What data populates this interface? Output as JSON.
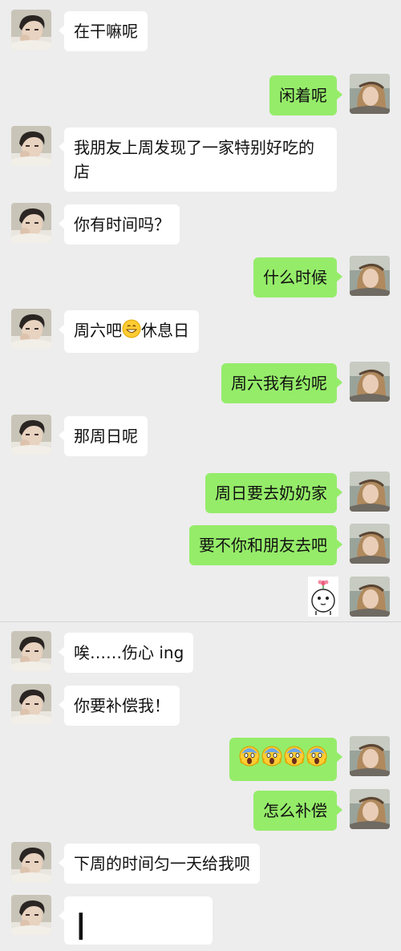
{
  "messages": [
    {
      "side": "in",
      "text": "在干嘛呢"
    },
    {
      "side": "out",
      "text": "闲着呢"
    },
    {
      "side": "in",
      "text": "我朋友上周发现了一家特别好吃的店"
    },
    {
      "side": "in",
      "text": "你有时间吗？"
    },
    {
      "side": "out",
      "text": "什么时候"
    },
    {
      "side": "in",
      "text_before": "周六吧",
      "emoji": "grin-emoji",
      "text_after": "休息日"
    },
    {
      "side": "out",
      "text": "周六我有约呢"
    },
    {
      "side": "in",
      "text": "那周日呢"
    },
    {
      "side": "out",
      "text": "周日要去奶奶家"
    },
    {
      "side": "out",
      "text": "要不你和朋友去吧"
    },
    {
      "side": "out",
      "sticker": "flower-head-sticker"
    },
    {
      "side": "in",
      "text": "唉……伤心 ing"
    },
    {
      "side": "in",
      "text": "你要补偿我！"
    },
    {
      "side": "out",
      "emoji": "screaming-face-emoji",
      "count": 4
    },
    {
      "side": "out",
      "text": "怎么补偿"
    },
    {
      "side": "in",
      "text": "下周的时间匀一天给我呗"
    },
    {
      "side": "in",
      "partial_text": "I"
    }
  ]
}
